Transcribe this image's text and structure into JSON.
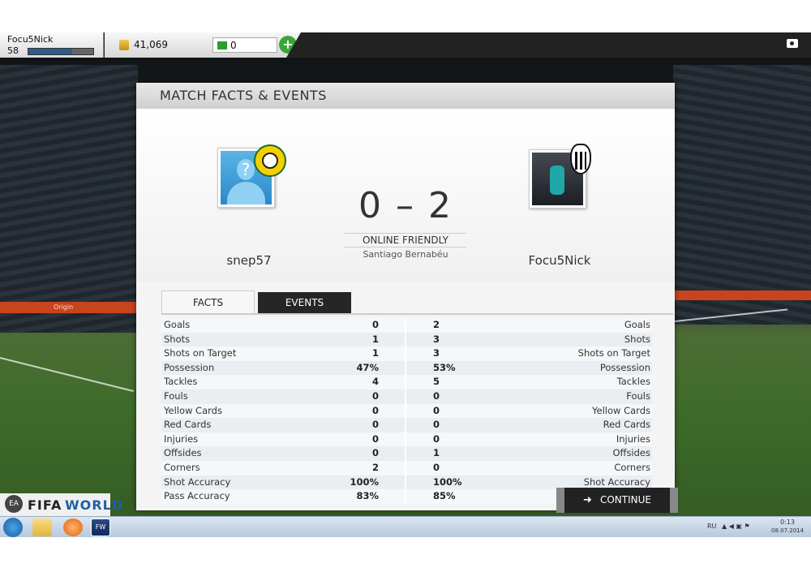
{
  "topbar": {
    "username": "Focu5Nick",
    "level": "58",
    "xp_progress": 0.68,
    "coins": "41,069",
    "points": "0",
    "add_label": "+"
  },
  "panel": {
    "title": "MATCH FACTS & EVENTS",
    "home_name": "snep57",
    "away_name": "Focu5Nick",
    "score": "0 – 2",
    "match_type": "ONLINE FRIENDLY",
    "stadium": "Santiago Bernabéu",
    "tabs": {
      "facts": "FACTS",
      "events": "EVENTS"
    }
  },
  "stats": [
    {
      "label": "Goals",
      "home": "0",
      "away": "2"
    },
    {
      "label": "Shots",
      "home": "1",
      "away": "3"
    },
    {
      "label": "Shots on Target",
      "home": "1",
      "away": "3"
    },
    {
      "label": "Possession",
      "home": "47%",
      "away": "53%"
    },
    {
      "label": "Tackles",
      "home": "4",
      "away": "5"
    },
    {
      "label": "Fouls",
      "home": "0",
      "away": "0"
    },
    {
      "label": "Yellow Cards",
      "home": "0",
      "away": "0"
    },
    {
      "label": "Red Cards",
      "home": "0",
      "away": "0"
    },
    {
      "label": "Injuries",
      "home": "0",
      "away": "0"
    },
    {
      "label": "Offsides",
      "home": "0",
      "away": "1"
    },
    {
      "label": "Corners",
      "home": "2",
      "away": "0"
    },
    {
      "label": "Shot Accuracy",
      "home": "100%",
      "away": "100%"
    },
    {
      "label": "Pass Accuracy",
      "home": "83%",
      "away": "85%"
    }
  ],
  "continue_label": "CONTINUE",
  "logo": {
    "ea": "EA",
    "fifa": "FIFA",
    "world": "WORLD"
  },
  "background": {
    "ad_text": "Origin"
  },
  "taskbar": {
    "lang": "RU",
    "time": "0:13",
    "date": "08.07.2014",
    "fifa_icon": "FW"
  },
  "icons": {
    "coins": "coins-icon",
    "points": "points-icon",
    "camera": "camera-icon",
    "arrow": "arrow-right-icon"
  }
}
